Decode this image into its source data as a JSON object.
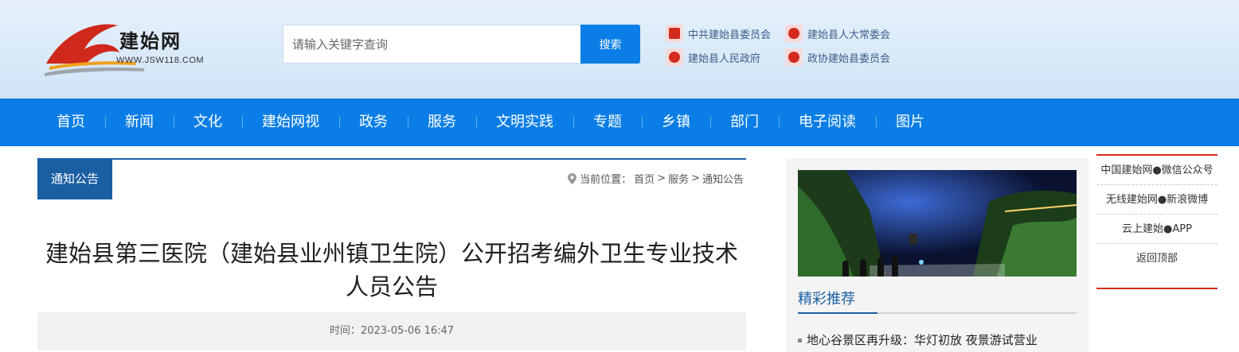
{
  "site": {
    "logo_text": "建始网",
    "logo_url_text": "WWW.JSW118.COM"
  },
  "search": {
    "placeholder": "请输入关键字查询",
    "button_label": "搜索"
  },
  "gov_links": [
    {
      "label": "中共建始县委员会",
      "icon": "party-emblem-icon"
    },
    {
      "label": "建始县人大常委会",
      "icon": "national-emblem-icon"
    },
    {
      "label": "建始县人民政府",
      "icon": "national-emblem-icon"
    },
    {
      "label": "政协建始县委员会",
      "icon": "cppcc-emblem-icon"
    }
  ],
  "nav": [
    "首页",
    "新闻",
    "文化",
    "建始网视",
    "政务",
    "服务",
    "文明实践",
    "专题",
    "乡镇",
    "部门",
    "电子阅读",
    "图片"
  ],
  "breadcrumb": {
    "section_tab": "通知公告",
    "location_label": "当前位置：",
    "trail": [
      "首页",
      "服务",
      "通知公告"
    ],
    "separator": ">"
  },
  "article": {
    "title": "建始县第三医院（建始县业州镇卫生院）公开招考编外卫生专业技术人员公告",
    "time_text": "时间：2023-05-06 16:47"
  },
  "sidebar": {
    "photo_icon": "night-scenic-photo",
    "recommend_tab": "精彩推荐",
    "items": [
      "地心谷景区再升级：华灯初放 夜景游试营业"
    ]
  },
  "float_panel": [
    "中国建始网●微信公众号",
    "无线建始网●新浪微博",
    "云上建始●APP",
    "返回顶部"
  ],
  "colors": {
    "nav_blue": "#0a7ee6",
    "dark_blue": "#1b5fa3",
    "red": "#d32a1e"
  }
}
